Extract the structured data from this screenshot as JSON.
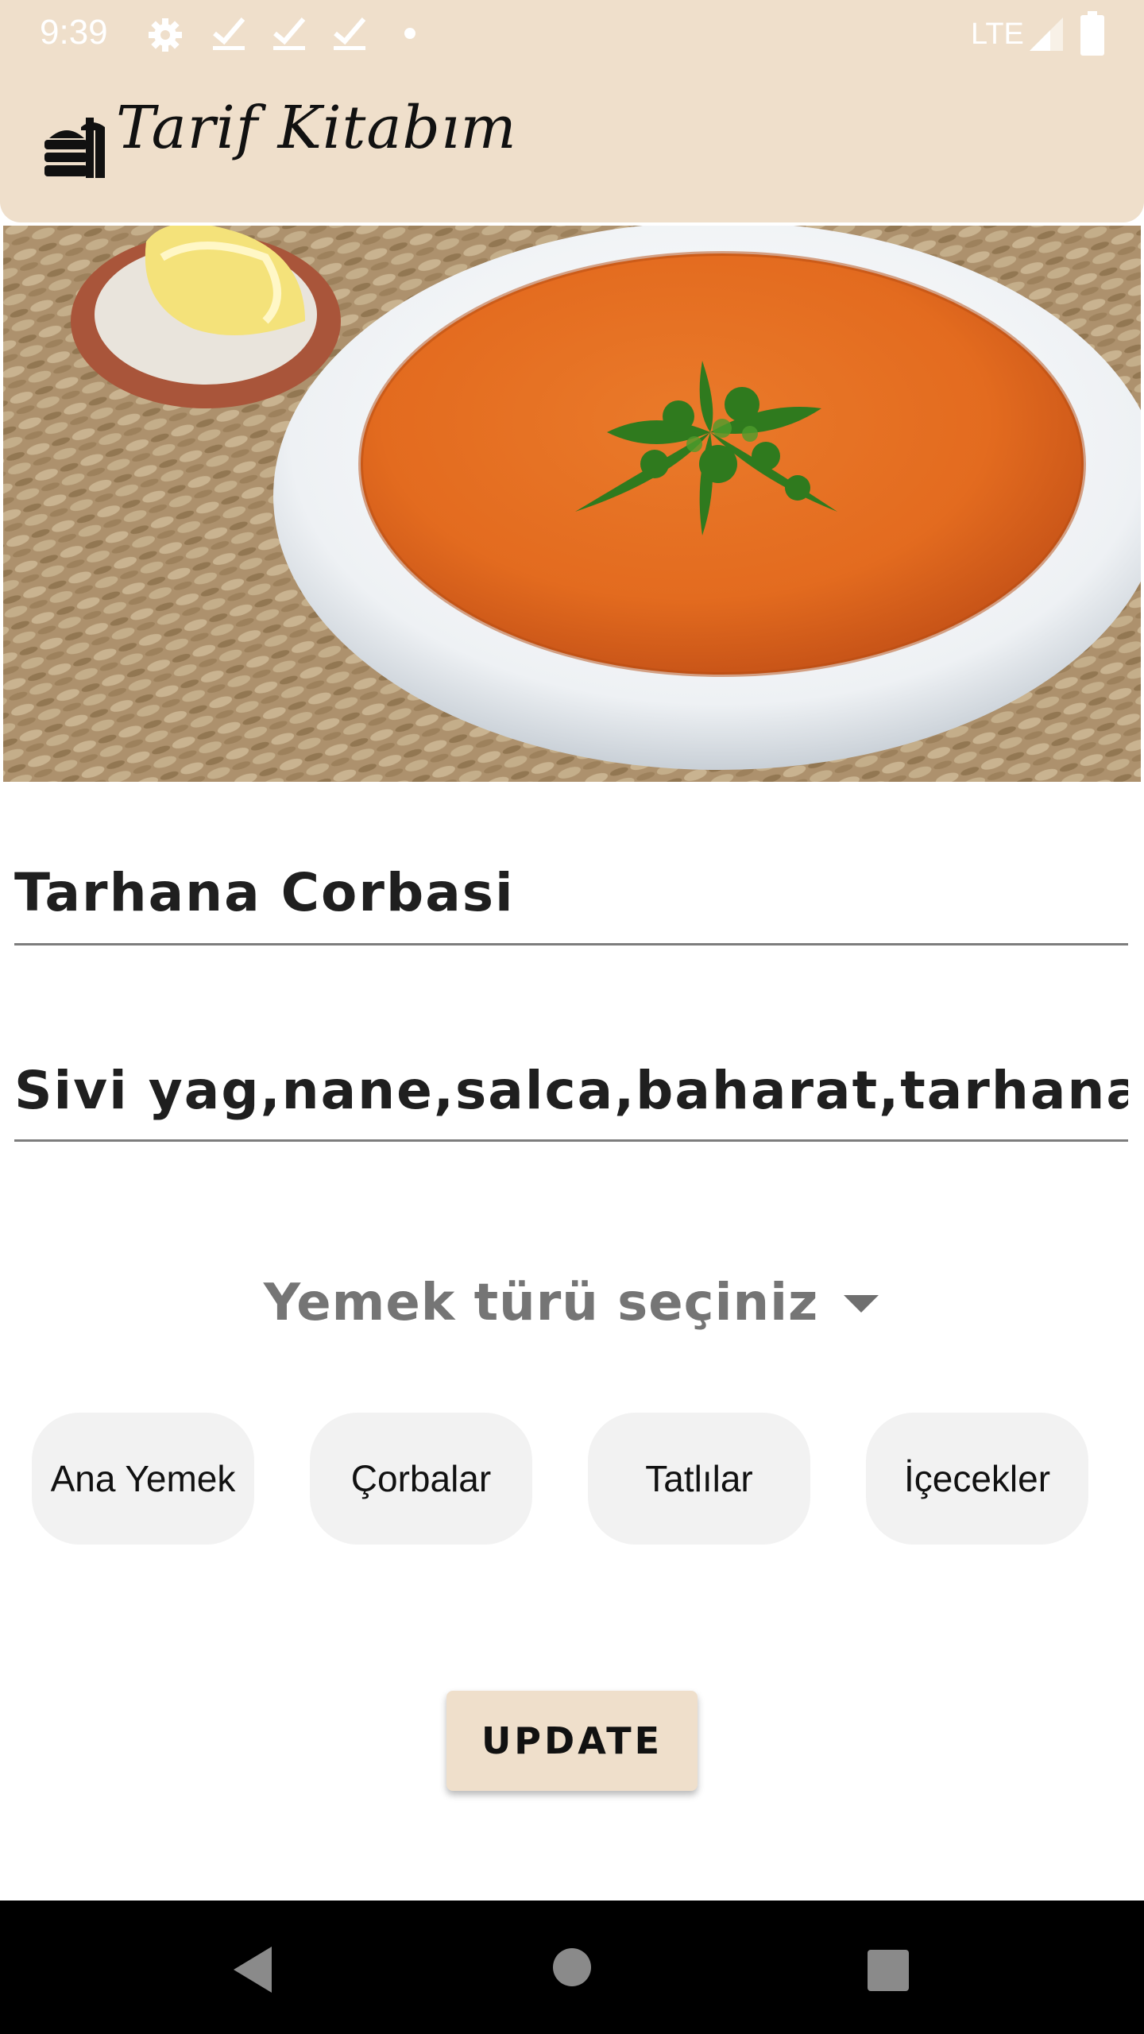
{
  "status_bar": {
    "time": "9:39",
    "network": "LTE",
    "icons": [
      "settings-icon",
      "check-icon",
      "check-icon",
      "check-icon",
      "dot-icon",
      "signal-icon",
      "battery-icon"
    ]
  },
  "app_bar": {
    "title": "Tarif Kitabım",
    "logo_icon": "food-tray-icon",
    "background": "#efdfcb"
  },
  "hero": {
    "image": "soup-bowl-photo"
  },
  "form": {
    "name_value": "Tarhana Corbasi",
    "ingredients_value": "Sivi yag,nane,salca,baharat,tarhana",
    "category_placeholder": "Yemek türü seçiniz",
    "categories": [
      "Ana Yemek",
      "Çorbalar",
      "Tatlılar",
      "İçecekler"
    ],
    "update_label": "UPDATE"
  },
  "nav_bar": {
    "icons": [
      "back-icon",
      "home-icon",
      "recents-icon"
    ]
  }
}
